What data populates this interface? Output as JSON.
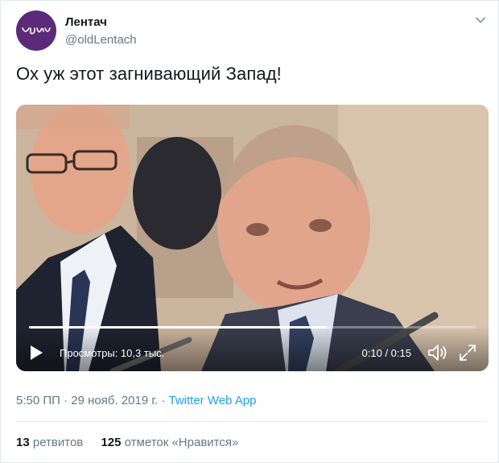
{
  "author": {
    "name": "Лентач",
    "handle": "@oldLentach",
    "avatar_color": "#5b2a78"
  },
  "tweet": {
    "text": "Ох уж этот загнивающий Запад!"
  },
  "video": {
    "views_label": "Просмотры: 10,3 тыс.",
    "time_label": "0:10 / 0:15",
    "progress": 0.667
  },
  "meta": {
    "time": "5:50 ПП",
    "date": "29 нояб. 2019 г.",
    "separator": "·",
    "app": "Twitter Web App"
  },
  "stats": {
    "retweets_count": "13",
    "retweets_label": "ретвитов",
    "likes_count": "125",
    "likes_label": "отметок «Нравится»"
  },
  "colors": {
    "link": "#1da1f2",
    "secondary": "#657786",
    "primary_text": "#14171a"
  },
  "icons": [
    "caret-down-icon",
    "play-icon",
    "volume-icon",
    "fullscreen-icon"
  ]
}
